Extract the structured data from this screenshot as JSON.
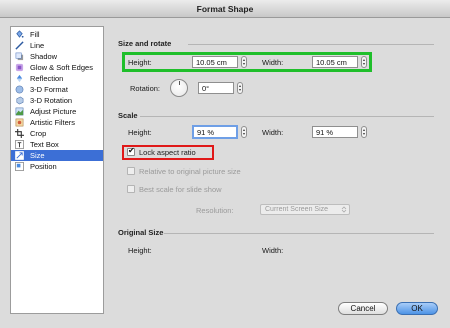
{
  "window": {
    "title": "Format Shape"
  },
  "sidebar": {
    "items": [
      {
        "label": "Fill",
        "icon": "fill-bucket-icon"
      },
      {
        "label": "Line",
        "icon": "line-icon"
      },
      {
        "label": "Shadow",
        "icon": "shadow-icon"
      },
      {
        "label": "Glow & Soft Edges",
        "icon": "glow-icon"
      },
      {
        "label": "Reflection",
        "icon": "reflection-icon"
      },
      {
        "label": "3-D Format",
        "icon": "3d-format-icon"
      },
      {
        "label": "3-D Rotation",
        "icon": "3d-rotation-icon"
      },
      {
        "label": "Adjust Picture",
        "icon": "adjust-picture-icon"
      },
      {
        "label": "Artistic Filters",
        "icon": "artistic-filters-icon"
      },
      {
        "label": "Crop",
        "icon": "crop-icon"
      },
      {
        "label": "Text Box",
        "icon": "text-box-icon"
      },
      {
        "label": "Size",
        "icon": "size-icon"
      },
      {
        "label": "Position",
        "icon": "position-icon"
      }
    ],
    "selected": "Size"
  },
  "size_rotate": {
    "title": "Size and rotate",
    "height_label": "Height:",
    "height_value": "10.05 cm",
    "width_label": "Width:",
    "width_value": "10.05 cm",
    "rotation_label": "Rotation:",
    "rotation_value": "0°"
  },
  "scale": {
    "title": "Scale",
    "height_label": "Height:",
    "height_value": "91 %",
    "width_label": "Width:",
    "width_value": "91 %",
    "lock_label": "Lock aspect ratio",
    "lock_checked": true,
    "relative_label": "Relative to original picture size",
    "best_scale_label": "Best scale for slide show",
    "resolution_label": "Resolution:",
    "resolution_value": "Current Screen Size"
  },
  "original": {
    "title": "Original Size",
    "height_label": "Height:",
    "width_label": "Width:"
  },
  "buttons": {
    "cancel": "Cancel",
    "ok": "OK"
  },
  "colors": {
    "selection": "#3c6fd6",
    "highlight_green": "#1fbf2b",
    "highlight_red": "#e01919",
    "ok_button": "#4d93e6"
  }
}
